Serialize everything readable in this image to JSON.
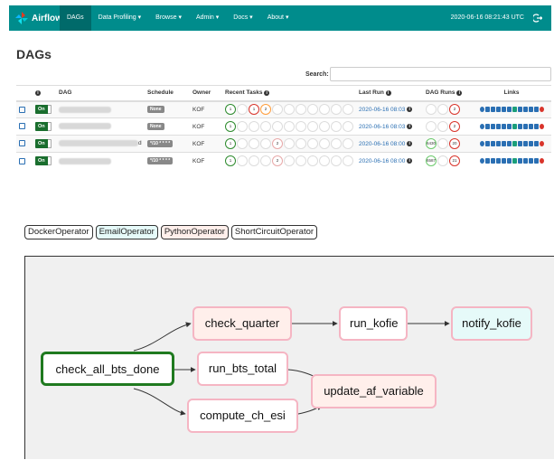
{
  "navbar": {
    "brand": "Airflow",
    "items": [
      {
        "label": "DAGs",
        "active": true
      },
      {
        "label": "Data Profiling ▾",
        "active": false
      },
      {
        "label": "Browse ▾",
        "active": false
      },
      {
        "label": "Admin ▾",
        "active": false
      },
      {
        "label": "Docs ▾",
        "active": false
      },
      {
        "label": "About ▾",
        "active": false
      }
    ],
    "clock": "2020-06-16 08:21:43 UTC",
    "logout_icon": "logout-icon"
  },
  "page": {
    "title": "DAGs",
    "search_label": "Search:",
    "search_value": ""
  },
  "table": {
    "headers": {
      "info": "",
      "dag": "DAG",
      "schedule": "Schedule",
      "owner": "Owner",
      "recent_tasks": "Recent Tasks",
      "last_run": "Last Run",
      "dag_runs": "DAG Runs",
      "links": "Links"
    },
    "rows": [
      {
        "toggle": "On",
        "schedule": "None",
        "owner": "KOF",
        "last_run": "2020-06-16 08:03",
        "recent_tasks": [
          {
            "state": "success",
            "count": "1"
          },
          {
            "state": "empty",
            "count": ""
          },
          {
            "state": "failed",
            "count": "1"
          },
          {
            "state": "upfail",
            "count": "2"
          },
          {
            "state": "empty",
            "count": ""
          },
          {
            "state": "empty",
            "count": ""
          },
          {
            "state": "empty",
            "count": ""
          },
          {
            "state": "empty",
            "count": ""
          },
          {
            "state": "empty",
            "count": ""
          },
          {
            "state": "empty",
            "count": ""
          },
          {
            "state": "empty",
            "count": ""
          }
        ],
        "dag_runs": [
          {
            "state": "empty",
            "count": ""
          },
          {
            "state": "empty",
            "count": ""
          },
          {
            "state": "failed",
            "count": "2"
          }
        ]
      },
      {
        "toggle": "On",
        "schedule": "None",
        "owner": "KOF",
        "last_run": "2020-06-16 08:03",
        "recent_tasks": [
          {
            "state": "success",
            "count": "1"
          },
          {
            "state": "empty",
            "count": ""
          },
          {
            "state": "empty",
            "count": ""
          },
          {
            "state": "empty",
            "count": ""
          },
          {
            "state": "empty",
            "count": ""
          },
          {
            "state": "empty",
            "count": ""
          },
          {
            "state": "empty",
            "count": ""
          },
          {
            "state": "empty",
            "count": ""
          },
          {
            "state": "empty",
            "count": ""
          },
          {
            "state": "empty",
            "count": ""
          },
          {
            "state": "empty",
            "count": ""
          }
        ],
        "dag_runs": [
          {
            "state": "empty",
            "count": ""
          },
          {
            "state": "empty",
            "count": ""
          },
          {
            "state": "failed",
            "count": "2"
          }
        ]
      },
      {
        "toggle": "On",
        "schedule": "*/10 * * * *",
        "owner": "KOF",
        "last_run": "2020-06-16 08:00",
        "recent_tasks": [
          {
            "state": "success",
            "count": "1"
          },
          {
            "state": "empty",
            "count": ""
          },
          {
            "state": "empty",
            "count": ""
          },
          {
            "state": "empty",
            "count": ""
          },
          {
            "state": "paled",
            "count": "2"
          },
          {
            "state": "empty",
            "count": ""
          },
          {
            "state": "empty",
            "count": ""
          },
          {
            "state": "empty",
            "count": ""
          },
          {
            "state": "empty",
            "count": ""
          },
          {
            "state": "empty",
            "count": ""
          },
          {
            "state": "empty",
            "count": ""
          }
        ],
        "dag_runs": [
          {
            "state": "running",
            "count": "6430"
          },
          {
            "state": "empty",
            "count": ""
          },
          {
            "state": "failed",
            "count": "20"
          }
        ]
      },
      {
        "toggle": "On",
        "schedule": "*/10 * * * *",
        "owner": "KOF",
        "last_run": "2020-06-16 08:00",
        "recent_tasks": [
          {
            "state": "success",
            "count": "1"
          },
          {
            "state": "empty",
            "count": ""
          },
          {
            "state": "empty",
            "count": ""
          },
          {
            "state": "empty",
            "count": ""
          },
          {
            "state": "paled",
            "count": "2"
          },
          {
            "state": "empty",
            "count": ""
          },
          {
            "state": "empty",
            "count": ""
          },
          {
            "state": "empty",
            "count": ""
          },
          {
            "state": "empty",
            "count": ""
          },
          {
            "state": "empty",
            "count": ""
          },
          {
            "state": "empty",
            "count": ""
          }
        ],
        "dag_runs": [
          {
            "state": "running",
            "count": "6587"
          },
          {
            "state": "empty",
            "count": ""
          },
          {
            "state": "failed",
            "count": "21"
          }
        ]
      }
    ],
    "partial_dag_suffix": "d"
  },
  "legend": [
    {
      "label": "DockerOperator",
      "color": "#ffffff"
    },
    {
      "label": "EmailOperator",
      "color": "#e6faf9"
    },
    {
      "label": "PythonOperator",
      "color": "#ffefeb"
    },
    {
      "label": "ShortCircuitOperator",
      "color": "#ffffff"
    }
  ],
  "graph": {
    "nodes": [
      {
        "id": "check_all_bts_done",
        "label": "check_all_bts_done",
        "fill": "#ffffff",
        "border": "#1f7a1f"
      },
      {
        "id": "check_quarter",
        "label": "check_quarter",
        "fill": "#ffefeb",
        "border": "#f5b5c3"
      },
      {
        "id": "run_kofie",
        "label": "run_kofie",
        "fill": "#ffffff",
        "border": "#f5b5c3"
      },
      {
        "id": "notify_kofie",
        "label": "notify_kofie",
        "fill": "#e6faf9",
        "border": "#f5b5c3"
      },
      {
        "id": "run_bts_total",
        "label": "run_bts_total",
        "fill": "#ffffff",
        "border": "#f5b5c3"
      },
      {
        "id": "update_af_variable",
        "label": "update_af_variable",
        "fill": "#ffefeb",
        "border": "#f5b5c3"
      },
      {
        "id": "compute_ch_esi",
        "label": "compute_ch_esi",
        "fill": "#ffffff",
        "border": "#f5b5c3"
      }
    ]
  }
}
